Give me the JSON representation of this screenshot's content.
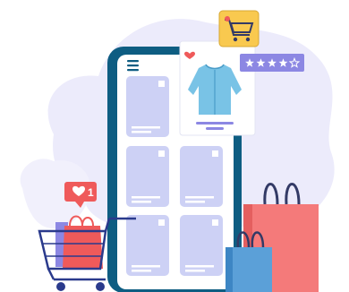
{
  "illustration": {
    "notification": {
      "count": "1",
      "icon": "heart-icon"
    },
    "rating": {
      "filled": 4,
      "total": 5,
      "icon": "star-icon"
    },
    "cart_badge": {
      "icon": "shopping-cart-icon"
    },
    "product": {
      "icon": "shirt-icon",
      "favorite_icon": "heart-icon"
    },
    "phone": {
      "menu_icon": "hamburger-menu-icon",
      "grid_items": 6
    },
    "colors": {
      "blob": "#ecebfb",
      "phone_frame": "#0e5d82",
      "screen": "#ffffff",
      "tile": "#cdd1f5",
      "accent_red": "#ef5a5a",
      "shirt": "#79c3e6",
      "rating_bg": "#8c87e3",
      "cart_badge": "#f9c94f",
      "bag_red": "#f47a7a",
      "bag_blue": "#5ba0d8",
      "cart_frame": "#2a3a8c"
    }
  }
}
